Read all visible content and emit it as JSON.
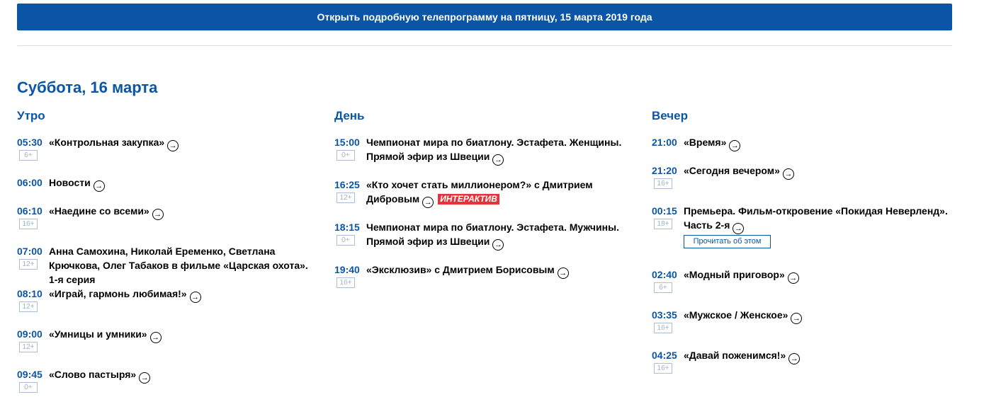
{
  "open_button": {
    "label": "Открыть подробную телепрограмму на пятницу, 15 марта 2019 года"
  },
  "day_title": "Суббота, 16 марта",
  "colors": {
    "accent": "#0b55a6",
    "badge": "#e5333a"
  },
  "columns": [
    {
      "title": "Утро",
      "programs": [
        {
          "time": "05:30",
          "title": "«Контрольная закупка»",
          "rating": "6+"
        },
        {
          "time": "06:00",
          "title": "Новости",
          "rating": ""
        },
        {
          "time": "06:10",
          "title": "«Наедине со всеми»",
          "rating": "16+"
        },
        {
          "time": "07:00",
          "title": "Анна Самохина, Николай Еременко, Светлана Крючкова, Олег Табаков в фильме «Царская охота». 1-я серия",
          "rating": "12+"
        },
        {
          "time": "08:10",
          "title": "«Играй, гармонь любимая!»",
          "rating": "12+"
        },
        {
          "time": "09:00",
          "title": "«Умницы и умники»",
          "rating": "12+"
        },
        {
          "time": "09:45",
          "title": "«Слово пастыря»",
          "rating": "0+"
        }
      ]
    },
    {
      "title": "День",
      "programs": [
        {
          "time": "15:00",
          "title": "Чемпионат мира по биатлону. Эстафета. Женщины. Прямой эфир из Швеции",
          "rating": "0+"
        },
        {
          "time": "16:25",
          "title": "«Кто хочет стать миллионером?» с Дмитрием Дибровым",
          "rating": "12+",
          "badge": "ИНТЕРАКТИВ"
        },
        {
          "time": "18:15",
          "title": "Чемпионат мира по биатлону. Эстафета. Мужчины. Прямой эфир из Швеции",
          "rating": "0+"
        },
        {
          "time": "19:40",
          "title": "«Эксклюзив» с Дмитрием Борисовым",
          "rating": "16+"
        }
      ]
    },
    {
      "title": "Вечер",
      "programs": [
        {
          "time": "21:00",
          "title": "«Время»",
          "rating": ""
        },
        {
          "time": "21:20",
          "title": "«Сегодня вечером»",
          "rating": "16+"
        },
        {
          "time": "00:15",
          "title": "Премьера. Фильм-откровение «Покидая Неверленд». Часть 2-я",
          "rating": "18+",
          "read_more": "Прочитать об этом"
        },
        {
          "time": "02:40",
          "title": "«Модный приговор»",
          "rating": "6+"
        },
        {
          "time": "03:35",
          "title": "«Мужское / Женское»",
          "rating": "16+"
        },
        {
          "time": "04:25",
          "title": "«Давай поженимся!»",
          "rating": "16+"
        }
      ]
    }
  ]
}
